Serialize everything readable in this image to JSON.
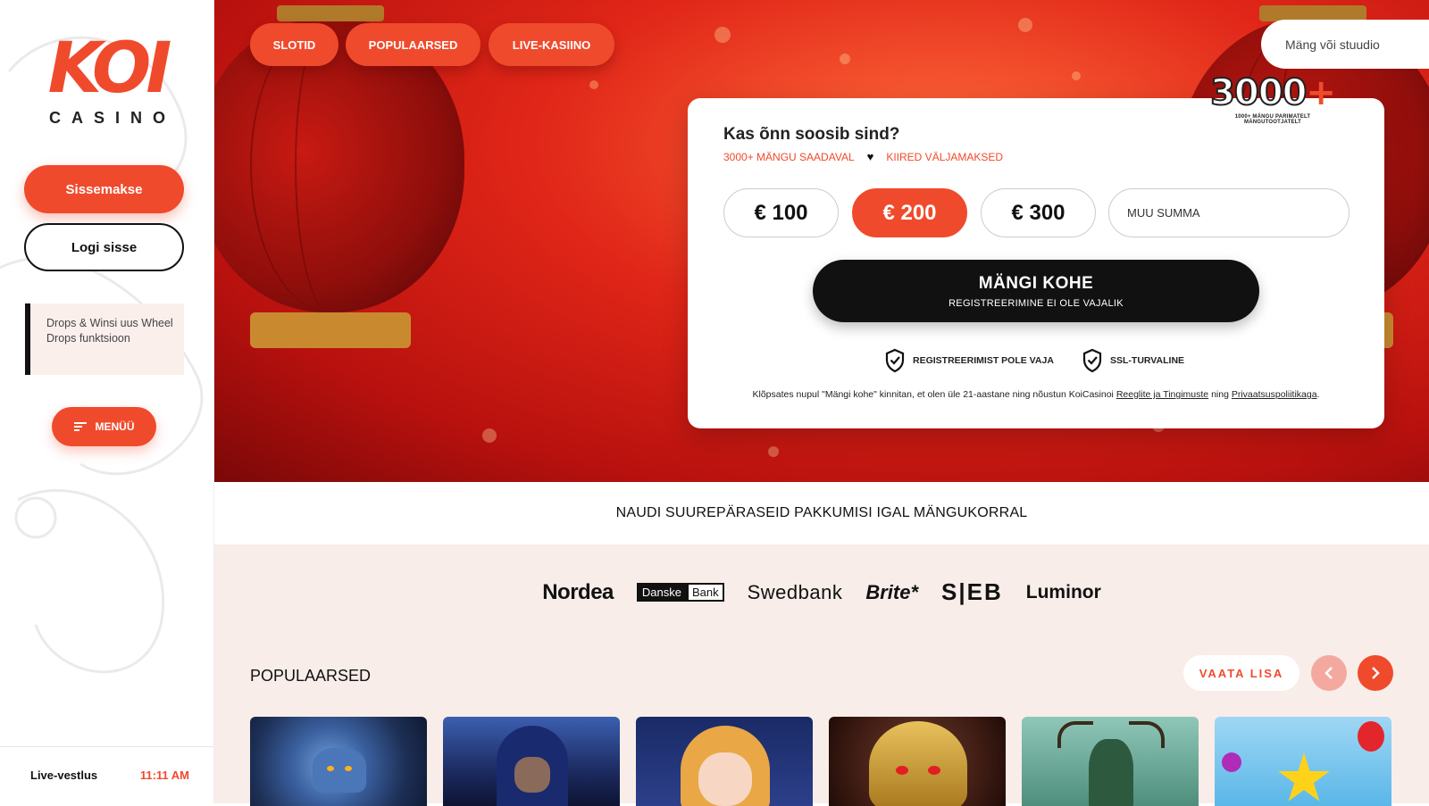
{
  "brand": {
    "logo_text": "KOI",
    "logo_sub": "CASINO",
    "accent": "#f04a2c"
  },
  "sidebar": {
    "deposit_label": "Sissemakse",
    "login_label": "Logi sisse",
    "promo_text": "Drops & Winsi uus Wheel Drops funktsioon",
    "menu_label": "MENÜÜ",
    "chat_label": "Live-vestlus",
    "chat_time": "11:11 AM"
  },
  "nav": {
    "items": [
      "SLOTID",
      "POPULAARSED",
      "LIVE-KASIINO"
    ]
  },
  "search": {
    "placeholder": "Mäng või stuudio"
  },
  "language": {
    "flag": "estonia-flag",
    "colors": [
      "#0072ce",
      "#000000",
      "#ffffff"
    ]
  },
  "deposit_card": {
    "title": "Kas õnn soosib sind?",
    "feature_1": "3000+ MÄNGU SAADAVAL",
    "feature_2": "KIIRED VÄLJAMAKSED",
    "badge_number": "3000",
    "badge_plus": "+",
    "badge_caption": "1000+ MÄNGU PARIMATELT MÄNGUTOOTJATELT",
    "amounts": [
      "€ 100",
      "€ 200",
      "€ 300"
    ],
    "selected_amount": "€ 200",
    "custom_placeholder": "MUU SUMMA",
    "play_label": "MÄNGI KOHE",
    "play_sub": "REGISTREERIMINE EI OLE VAJALIK",
    "trust_1": "REGISTREERIMIST POLE VAJA",
    "trust_2": "SSL-TURVALINE",
    "legal_prefix": "Klõpsates nupul \"Mängi kohe\" kinnitan, et olen üle 21-aastane ning nõustun KoiCasinoi",
    "legal_link_1": "Reeglite ja Tingimuste",
    "legal_mid": "ning",
    "legal_link_2": "Privaatsuspoliitikaga",
    "legal_end": "."
  },
  "tagline": "NAUDI SUUREPÄRASEID PAKKUMISI IGAL MÄNGUKORRAL",
  "banks": {
    "nordea": "Nordea",
    "danske_1": "Danske",
    "danske_2": "Bank",
    "swedbank": "Swedbank",
    "brite": "Brite*",
    "seb": "S|EB",
    "luminor": "Luminor"
  },
  "popular": {
    "title": "POPULAARSED",
    "more_label": "VAATA LISA",
    "prev_icon": "chevron-left-icon",
    "next_icon": "chevron-right-icon",
    "games": [
      "werewolf-game",
      "hooded-wizard-game",
      "anime-girl-game",
      "golden-warrior-game",
      "forest-spirit-game",
      "fruit-star-game"
    ]
  }
}
